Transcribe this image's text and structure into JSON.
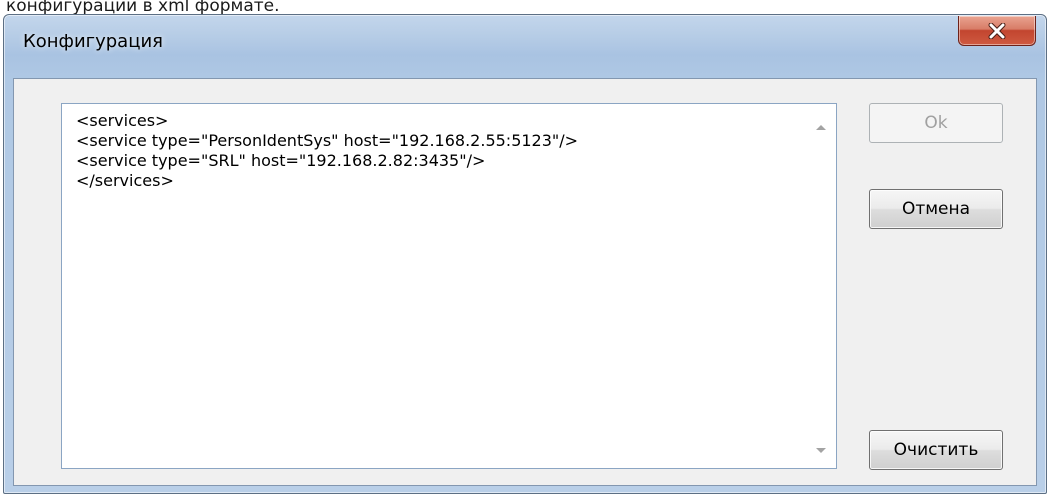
{
  "document": {
    "cropped_text": "конфигурации в xml формате."
  },
  "window": {
    "title": "Конфигурация",
    "close_icon": "close-x-icon"
  },
  "editor": {
    "lines": [
      "<services>",
      "<service type=\"PersonIdentSys\" host=\"192.168.2.55:5123\"/>",
      "<service type=\"SRL\" host=\"192.168.2.82:3435\"/>",
      "</services>"
    ],
    "scroll_up_icon": "scroll-up-arrow-icon",
    "scroll_down_icon": "scroll-down-arrow-icon"
  },
  "buttons": {
    "ok": "Ok",
    "ok_enabled": false,
    "cancel": "Отмена",
    "clear": "Очистить"
  },
  "colors": {
    "title_bar": "#b7cde6",
    "close_button": "#c2452f",
    "client_background": "#f0f0f0"
  }
}
